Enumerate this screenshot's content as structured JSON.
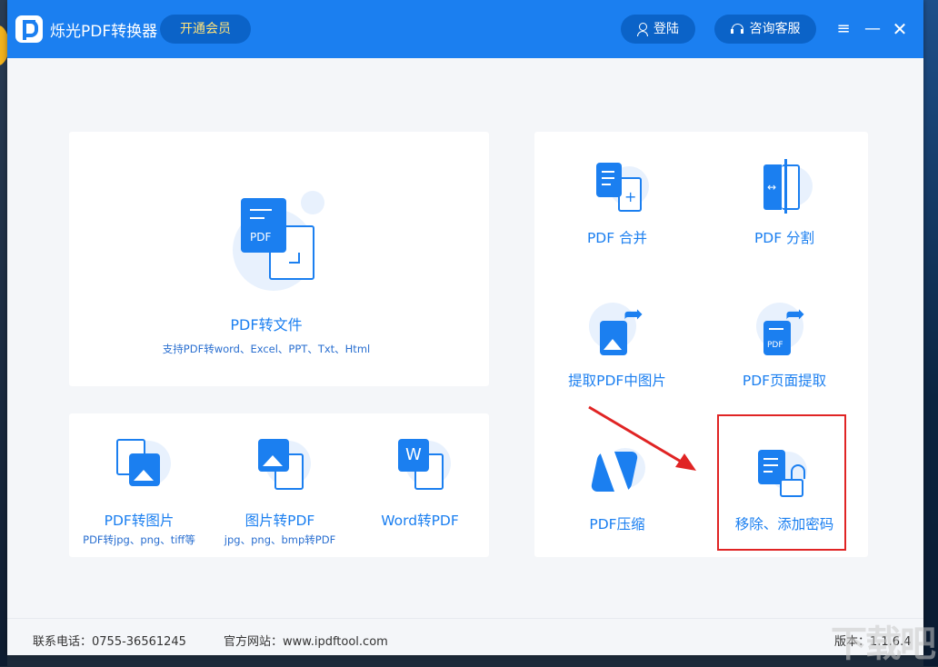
{
  "titlebar": {
    "app_title": "烁光PDF转换器",
    "vip_label": "开通会员",
    "login_label": "登陆",
    "service_label": "咨询客服",
    "menu_glyph": "≡",
    "min_glyph": "—",
    "close_glyph": "✕"
  },
  "big_card": {
    "badge": "PDF",
    "title": "PDF转文件",
    "subtitle": "支持PDF转word、Excel、PPT、Txt、Html"
  },
  "bottom_tools": [
    {
      "label": "PDF转图片",
      "sub": "PDF转jpg、png、tiff等"
    },
    {
      "label": "图片转PDF",
      "sub": "jpg、png、bmp转PDF"
    },
    {
      "label": "Word转PDF",
      "sub": "",
      "badge": "W"
    }
  ],
  "right_tools": [
    {
      "label": "PDF 合并"
    },
    {
      "label": "PDF 分割"
    },
    {
      "label": "提取PDF中图片"
    },
    {
      "label": "PDF页面提取",
      "badge": "PDF"
    },
    {
      "label": "PDF压缩"
    },
    {
      "label": "移除、添加密码"
    }
  ],
  "footer": {
    "phone": "联系电话：0755-36561245",
    "website": "官方网站：www.ipdftool.com",
    "version": "版本：1.1.6.4"
  },
  "watermark": "下载吧",
  "colors": {
    "brand": "#1b7ff0",
    "highlight": "#e02424"
  }
}
